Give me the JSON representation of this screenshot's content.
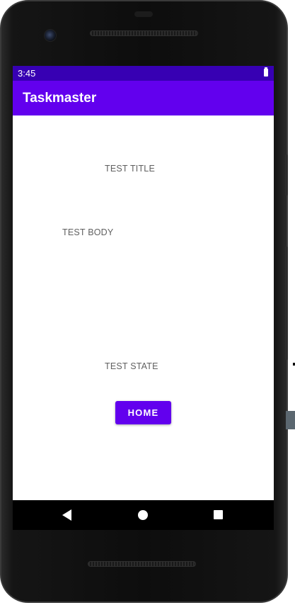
{
  "colors": {
    "primary": "#6200ee",
    "status_bar": "#3700b3",
    "content_text": "#606060"
  },
  "status_bar": {
    "time": "3:45",
    "battery_icon": "battery-full-icon"
  },
  "app_bar": {
    "title": "Taskmaster"
  },
  "task": {
    "title": "TEST TITLE",
    "body": "TEST BODY",
    "state": "TEST STATE"
  },
  "buttons": {
    "home_label": "HOME"
  },
  "nav_bar": {
    "back_icon": "back-triangle-icon",
    "home_icon": "home-circle-icon",
    "recents_icon": "recents-square-icon"
  }
}
